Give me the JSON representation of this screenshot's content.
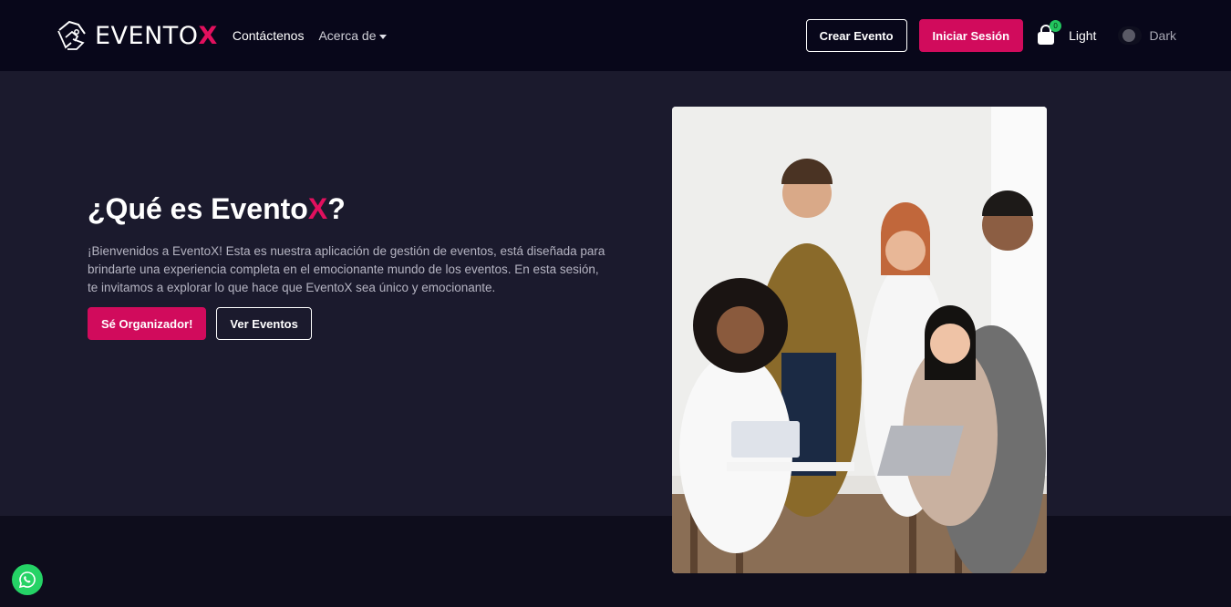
{
  "nav": {
    "brand_main": "EVENTO",
    "brand_accent": "X",
    "links": [
      {
        "label": "Contáctenos"
      },
      {
        "label": "Acerca de"
      }
    ],
    "create_event": "Crear Evento",
    "login": "Iniciar Sesión",
    "cart_count": "0",
    "theme_light": "Light",
    "theme_dark": "Dark"
  },
  "hero": {
    "title_prefix": "¿Qué es Evento",
    "title_accent": "X",
    "title_suffix": "?",
    "description": "¡Bienvenidos a EventoX! Esta es nuestra aplicación de gestión de eventos, está diseñada para brindarte una experiencia completa en el emocionante mundo de los eventos. En esta sesión, te invitamos a explorar lo que hace que EventoX sea único y emocionante.",
    "primary_button": "Sé Organizador!",
    "secondary_button": "Ver Eventos"
  },
  "colors": {
    "accent": "#d10b5c",
    "navbar_bg": "#08071a",
    "hero_bg": "#1b1a2d",
    "page_bg": "#0e0d1c",
    "whatsapp": "#25d366"
  },
  "icons": {
    "brand": "eventox-logo-icon",
    "dropdown": "caret-down-icon",
    "cart": "shopping-bag-icon",
    "floating": "whatsapp-icon"
  }
}
